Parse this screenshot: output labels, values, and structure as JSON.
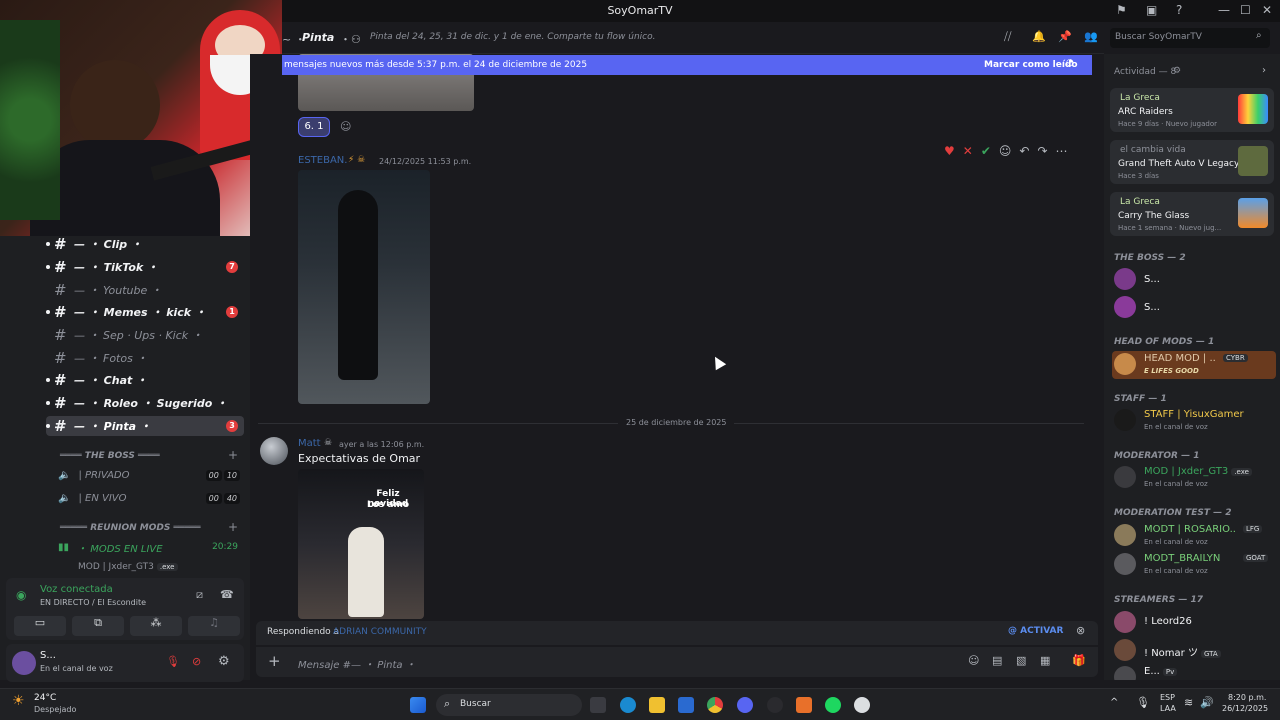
{
  "window": {
    "title": "SoyOmarTV"
  },
  "channel_header": {
    "name": "Pinta",
    "topic": "Pinta del 24, 25, 31 de dic. y 1 de ene. Comparte tu flow único.",
    "search_placeholder": "Buscar SoyOmarTV"
  },
  "new_messages": {
    "text": "mensajes nuevos más desde 5:37 p.m. el 24 de diciembre de 2025",
    "action": "Marcar como leído"
  },
  "reaction": {
    "label": "6.",
    "count": "1"
  },
  "messages": [
    {
      "author": "ESTEBAN.",
      "timestamp": "24/12/2025 11:53 p.m."
    },
    {
      "author": "Matt",
      "timestamp": "ayer a las 12:06 p.m.",
      "text": "Expectativas de Omar",
      "image_caption_1": "Feliz navidad",
      "image_caption_2": "Los amo"
    }
  ],
  "date_divider": "25 de diciembre de 2025",
  "reply_bar": {
    "prefix": "Respondiendo a",
    "target": "ADRIAN COMMUNITY",
    "action": "ACTIVAR"
  },
  "composer": {
    "placeholder": "Mensaje #— ・ Pinta ・"
  },
  "sidebar": {
    "channels": [
      {
        "name": "— ・ Clip ・",
        "unread": true,
        "badge": ""
      },
      {
        "name": "— ・ TikTok ・",
        "unread": true,
        "badge": "7"
      },
      {
        "name": "— ・ Youtube ・",
        "unread": false,
        "badge": ""
      },
      {
        "name": "— ・ Memes ・ kick ・",
        "unread": true,
        "badge": "1"
      },
      {
        "name": "— ・ Sep · Ups · Kick ・",
        "unread": false,
        "badge": ""
      },
      {
        "name": "— ・ Fotos ・",
        "unread": false,
        "badge": ""
      },
      {
        "name": "— ・ Chat ・",
        "unread": true,
        "badge": ""
      },
      {
        "name": "— ・ Roleo ・ Sugerido ・",
        "unread": true,
        "badge": ""
      },
      {
        "name": "— ・ Pinta ・",
        "unread": true,
        "badge": "3"
      }
    ],
    "cat_boss": "════ THE BOSS ════",
    "voice_private": {
      "name": "| PRIVADO",
      "c1": "00",
      "c2": "10"
    },
    "voice_live": {
      "name": "| EN VIVO",
      "c1": "00",
      "c2": "40"
    },
    "cat_mods": "═════ REUNION MODS ═════",
    "mods_live": {
      "name": "・ MODS EN LIVE",
      "time": "20:29"
    },
    "mods_member": "MOD | Jxder_GT3",
    "mods_member_tag": ".exe"
  },
  "voice": {
    "status": "Voz conectada",
    "sub": "EN DIRECTO",
    "place": "/ El Escondite"
  },
  "user": {
    "name": "S...",
    "status": "En el canal de voz"
  },
  "activity": {
    "header": "Actividad — 8",
    "cards": [
      {
        "user": "La Greca",
        "game": "ARC Raiders",
        "time": "Hace 9 días",
        "extra": "Nuevo jugador"
      },
      {
        "user": "el cambia vida",
        "game": "Grand Theft Auto V Legacy",
        "time": "Hace 3 días",
        "extra": ""
      },
      {
        "user": "La Greca",
        "game": "Carry The Glass",
        "time": "Hace 1 semana",
        "extra": "Nuevo jug..."
      }
    ]
  },
  "members": {
    "boss_header": "THE BOSS — 2",
    "boss": [
      "S...",
      "S..."
    ],
    "headmods_header": "HEAD OF MODS — 1",
    "headmod": {
      "name": "HEAD MOD | ...",
      "tag": "CYBR",
      "sub": "E LIFES GOOD"
    },
    "staff_header": "STAFF — 1",
    "staff": {
      "name": "STAFF | YisuxGamer",
      "sub": "En el canal de voz"
    },
    "moderator_header": "MODERATOR — 1",
    "moderator": {
      "name": "MOD | Jxder_GT3",
      "tag": ".exe",
      "sub": "En el canal de voz"
    },
    "modtest_header": "MODERATION TEST — 2",
    "modtest": [
      {
        "name": "MODT | ROSARIO...",
        "tag": "LFG",
        "sub": "En el canal de voz"
      },
      {
        "name": "MODT_BRAILYN",
        "tag": "GOAT",
        "sub": "En el canal de voz"
      }
    ],
    "streamers_header": "STREAMERS — 17",
    "streamers": [
      {
        "name": "! Leord26",
        "tag": ""
      },
      {
        "name": "! Nomar ツ",
        "tag": "GTA"
      },
      {
        "name": "E...",
        "tag": "Pv"
      }
    ]
  },
  "taskbar": {
    "weather_temp": "24°C",
    "weather_desc": "Despejado",
    "search": "Buscar",
    "lang1": "ESP",
    "lang2": "LAA",
    "time": "8:20 p.m.",
    "date": "26/12/2025"
  }
}
